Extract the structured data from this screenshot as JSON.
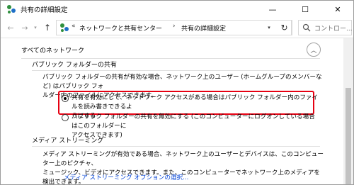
{
  "window": {
    "title": "共有の詳細設定",
    "minimize_glyph": "—",
    "maximize_glyph": "☐",
    "close_glyph": "✕"
  },
  "nav": {
    "back_glyph": "←",
    "forward_glyph": "→",
    "dropdown_glyph": "▾",
    "up_glyph": "↑"
  },
  "address": {
    "overflow": "«",
    "crumbs": [
      "ネットワークと共有センター",
      "共有の詳細設定"
    ],
    "separator": "›",
    "dropdown_glyph": "▾",
    "refresh_glyph": "↻"
  },
  "search": {
    "placeholder": "コントロー..."
  },
  "content": {
    "section_title": "すべてのネットワーク",
    "collapse_glyph": "︿",
    "public_folder": {
      "title": "パブリック フォルダーの共有",
      "description_line1": "パブリック フォルダーの共有が有効な場合、ネットワーク上のユーザー (ホームグループのメンバーなど) はパブリック フォ",
      "description_line2": "ルダー内のファイルにアクセスできます。",
      "options": [
        {
          "line1": "共有を有効にして、ネットワーク アクセスがある場合はパブリック フォルダー内のファイルを読み書きできるよ",
          "line2": "うにする",
          "checked": true
        },
        {
          "line1": "パブリック フォルダーの共有を無効にする (このコンピューターにログオンしている場合はこのフォルダーに",
          "line2": "アクセスできます)",
          "checked": false
        }
      ]
    },
    "media_streaming": {
      "title": "メディア ストリーミング",
      "description_line1": "メディア ストリーミングが有効である場合、ネットワーク上のユーザーとデバイスは、このコンピューター上のピクチャ、",
      "description_line2": "ミュージック、ビデオにアクセスできます。また、このコンピューターでネットワーク上のメディアを検出できます。",
      "link": "メディア ストリーミング オプションの選択..."
    }
  },
  "colors": {
    "highlight": "#e60012",
    "link": "#0645d6",
    "icon_green": "#2f8f3e",
    "icon_blue": "#1d6fc7"
  }
}
